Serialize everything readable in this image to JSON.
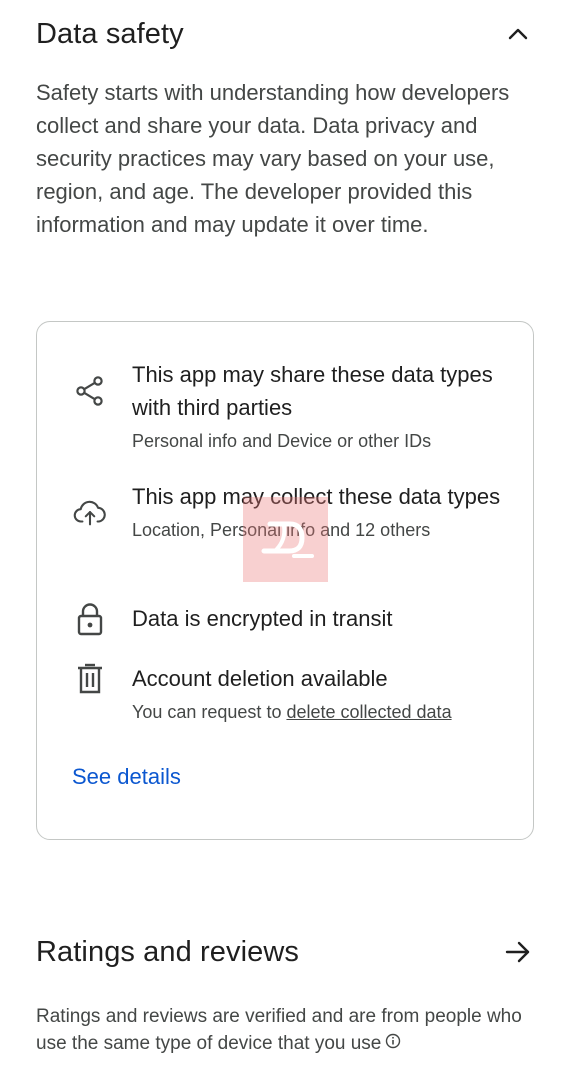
{
  "data_safety": {
    "title": "Data safety",
    "intro": "Safety starts with understanding how developers collect and share your data. Data privacy and security practices may vary based on your use, region, and age. The developer provided this information and may update it over time.",
    "collapse_icon": "chevron-up-icon",
    "items": [
      {
        "icon": "share-icon",
        "title": "This app may share these data types with third parties",
        "subtitle": "Personal info and Device or other IDs"
      },
      {
        "icon": "cloud-upload-icon",
        "title": "This app may collect these data types",
        "subtitle": "Location, Personal info and 12 others"
      },
      {
        "icon": "lock-icon",
        "title": "Data is encrypted in transit"
      },
      {
        "icon": "trash-icon",
        "title": "Account deletion available",
        "subtitle_prefix": "You can request to ",
        "subtitle_link": "delete collected data"
      }
    ],
    "see_details": "See details",
    "link_color": "#0b57d0"
  },
  "ratings": {
    "title": "Ratings and reviews",
    "arrow_icon": "arrow-right-icon",
    "description": "Ratings and reviews are verified and are from people who use the same type of device that you use",
    "info_icon": "info-icon"
  }
}
